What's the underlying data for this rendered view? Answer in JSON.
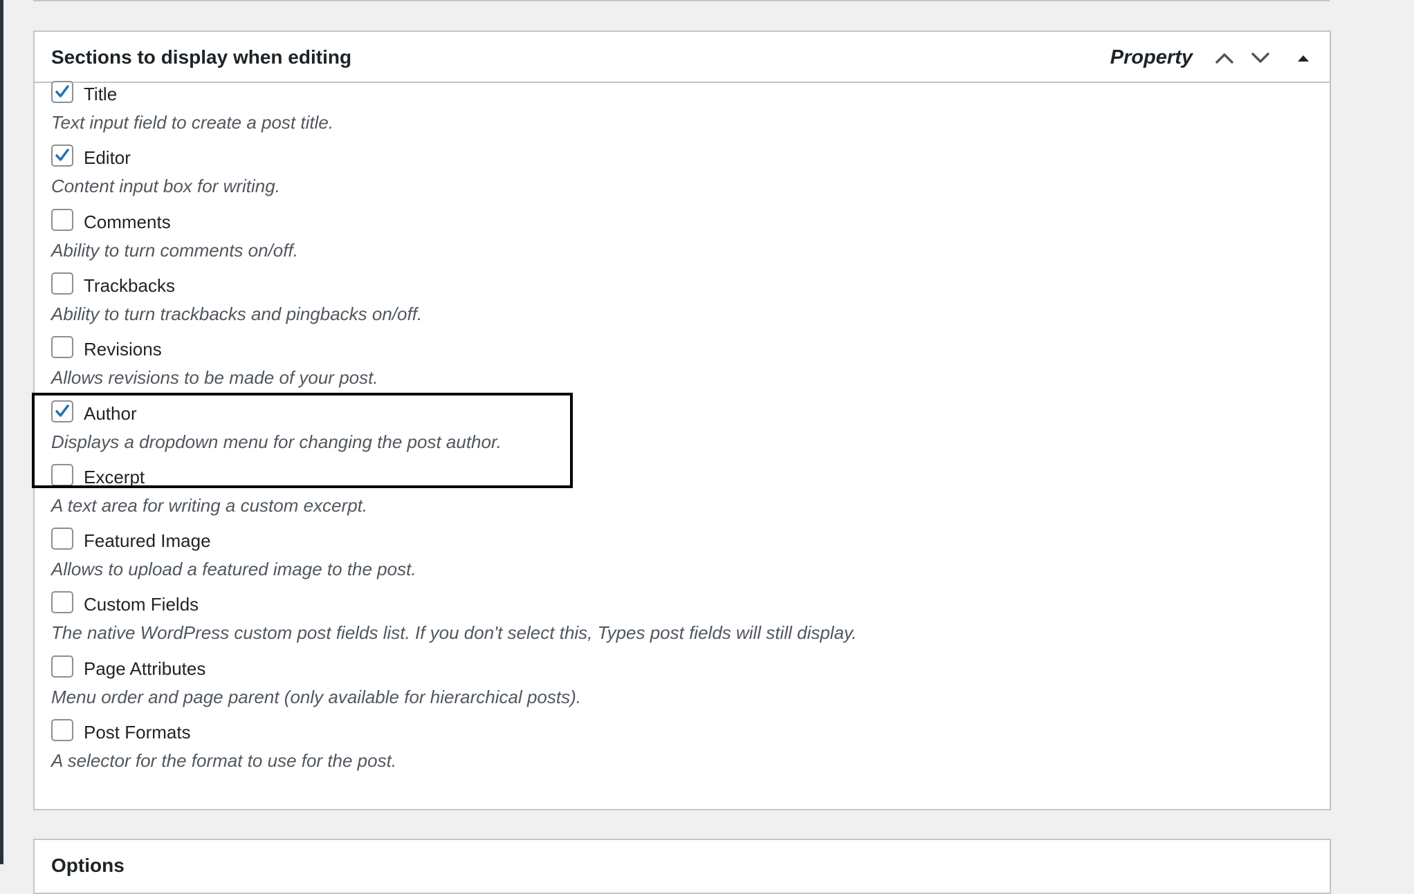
{
  "metabox": {
    "title": "Sections to display when editing",
    "post_type": "Property",
    "controls": {
      "move_up_icon": "chevron-up-icon",
      "move_down_icon": "chevron-down-icon",
      "toggle_icon": "triangle-up-icon"
    },
    "options": [
      {
        "key": "title",
        "label": "Title",
        "description": "Text input field to create a post title.",
        "checked": true
      },
      {
        "key": "editor",
        "label": "Editor",
        "description": "Content input box for writing.",
        "checked": true
      },
      {
        "key": "comments",
        "label": "Comments",
        "description": "Ability to turn comments on/off.",
        "checked": false
      },
      {
        "key": "trackbacks",
        "label": "Trackbacks",
        "description": "Ability to turn trackbacks and pingbacks on/off.",
        "checked": false
      },
      {
        "key": "revisions",
        "label": "Revisions",
        "description": "Allows revisions to be made of your post.",
        "checked": false
      },
      {
        "key": "author",
        "label": "Author",
        "description": "Displays a dropdown menu for changing the post author.",
        "checked": true
      },
      {
        "key": "excerpt",
        "label": "Excerpt",
        "description": "A text area for writing a custom excerpt.",
        "checked": false
      },
      {
        "key": "featured-image",
        "label": "Featured Image",
        "description": "Allows to upload a featured image to the post.",
        "checked": false
      },
      {
        "key": "custom-fields",
        "label": "Custom Fields",
        "description": "The native WordPress custom post fields list. If you don't select this, Types post fields will still display.",
        "checked": false
      },
      {
        "key": "page-attributes",
        "label": "Page Attributes",
        "description": "Menu order and page parent (only available for hierarchical posts).",
        "checked": false
      },
      {
        "key": "post-formats",
        "label": "Post Formats",
        "description": "A selector for the format to use for the post.",
        "checked": false
      }
    ]
  },
  "next_metabox": {
    "title": "Options"
  },
  "colors": {
    "checkmark": "#2271b1",
    "highlight_border": "#000000",
    "box_border": "#c3c4c7",
    "page_background": "#f0f0f1"
  }
}
